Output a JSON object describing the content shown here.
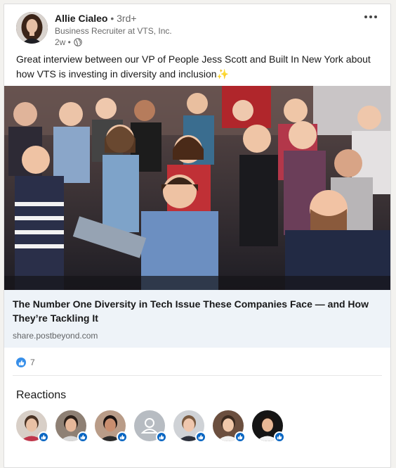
{
  "post": {
    "author_name": "Allie Cialeo",
    "degree": " • 3rd+",
    "headline": "Business Recruiter at VTS, Inc.",
    "time": "2w •",
    "visibility_icon": "globe-icon",
    "more_icon": "more-horizontal-icon",
    "text": "Great interview between our VP of People Jess Scott and Built In New York about how VTS is investing in diversity and inclusion",
    "emoji": "✨"
  },
  "link": {
    "title": "The Number One Diversity in Tech Issue These Companies Face — and How They’re Tackling It",
    "source": "share.postbeyond.com"
  },
  "social": {
    "reaction_icon": "like-icon",
    "count": "7"
  },
  "reactions": {
    "title": "Reactions",
    "people": [
      {
        "icon": "avatar",
        "bg": "#d8cfc7",
        "skin": "#e9c1a5",
        "hair": "#4a3324",
        "shirt": "#c0364b"
      },
      {
        "icon": "avatar",
        "bg": "#8e8074",
        "skin": "#e6b89a",
        "hair": "#2b1f18",
        "shirt": "#d9d9d9"
      },
      {
        "icon": "avatar",
        "bg": "#b99c88",
        "skin": "#c98e6f",
        "hair": "#1a1210",
        "shirt": "#2a2a2a"
      },
      {
        "icon": "default-avatar",
        "bg": "#b7bcc2"
      },
      {
        "icon": "avatar",
        "bg": "#cfd2d6",
        "skin": "#efc7ae",
        "hair": "#7a5a40",
        "shirt": "#2b2f3a"
      },
      {
        "icon": "avatar",
        "bg": "#6b4f3f",
        "skin": "#f0c8aa",
        "hair": "#3b2a1f",
        "shirt": "#f2f2f2"
      },
      {
        "icon": "avatar",
        "bg": "#151515",
        "skin": "#e8b896",
        "hair": "#1c1410",
        "shirt": "#f5f5f5"
      }
    ],
    "badge_icon": "like-badge-icon"
  },
  "colors": {
    "like_blue": "#0a66c2",
    "like_light": "#378fe9",
    "link_meta_bg": "#eef3f8"
  }
}
